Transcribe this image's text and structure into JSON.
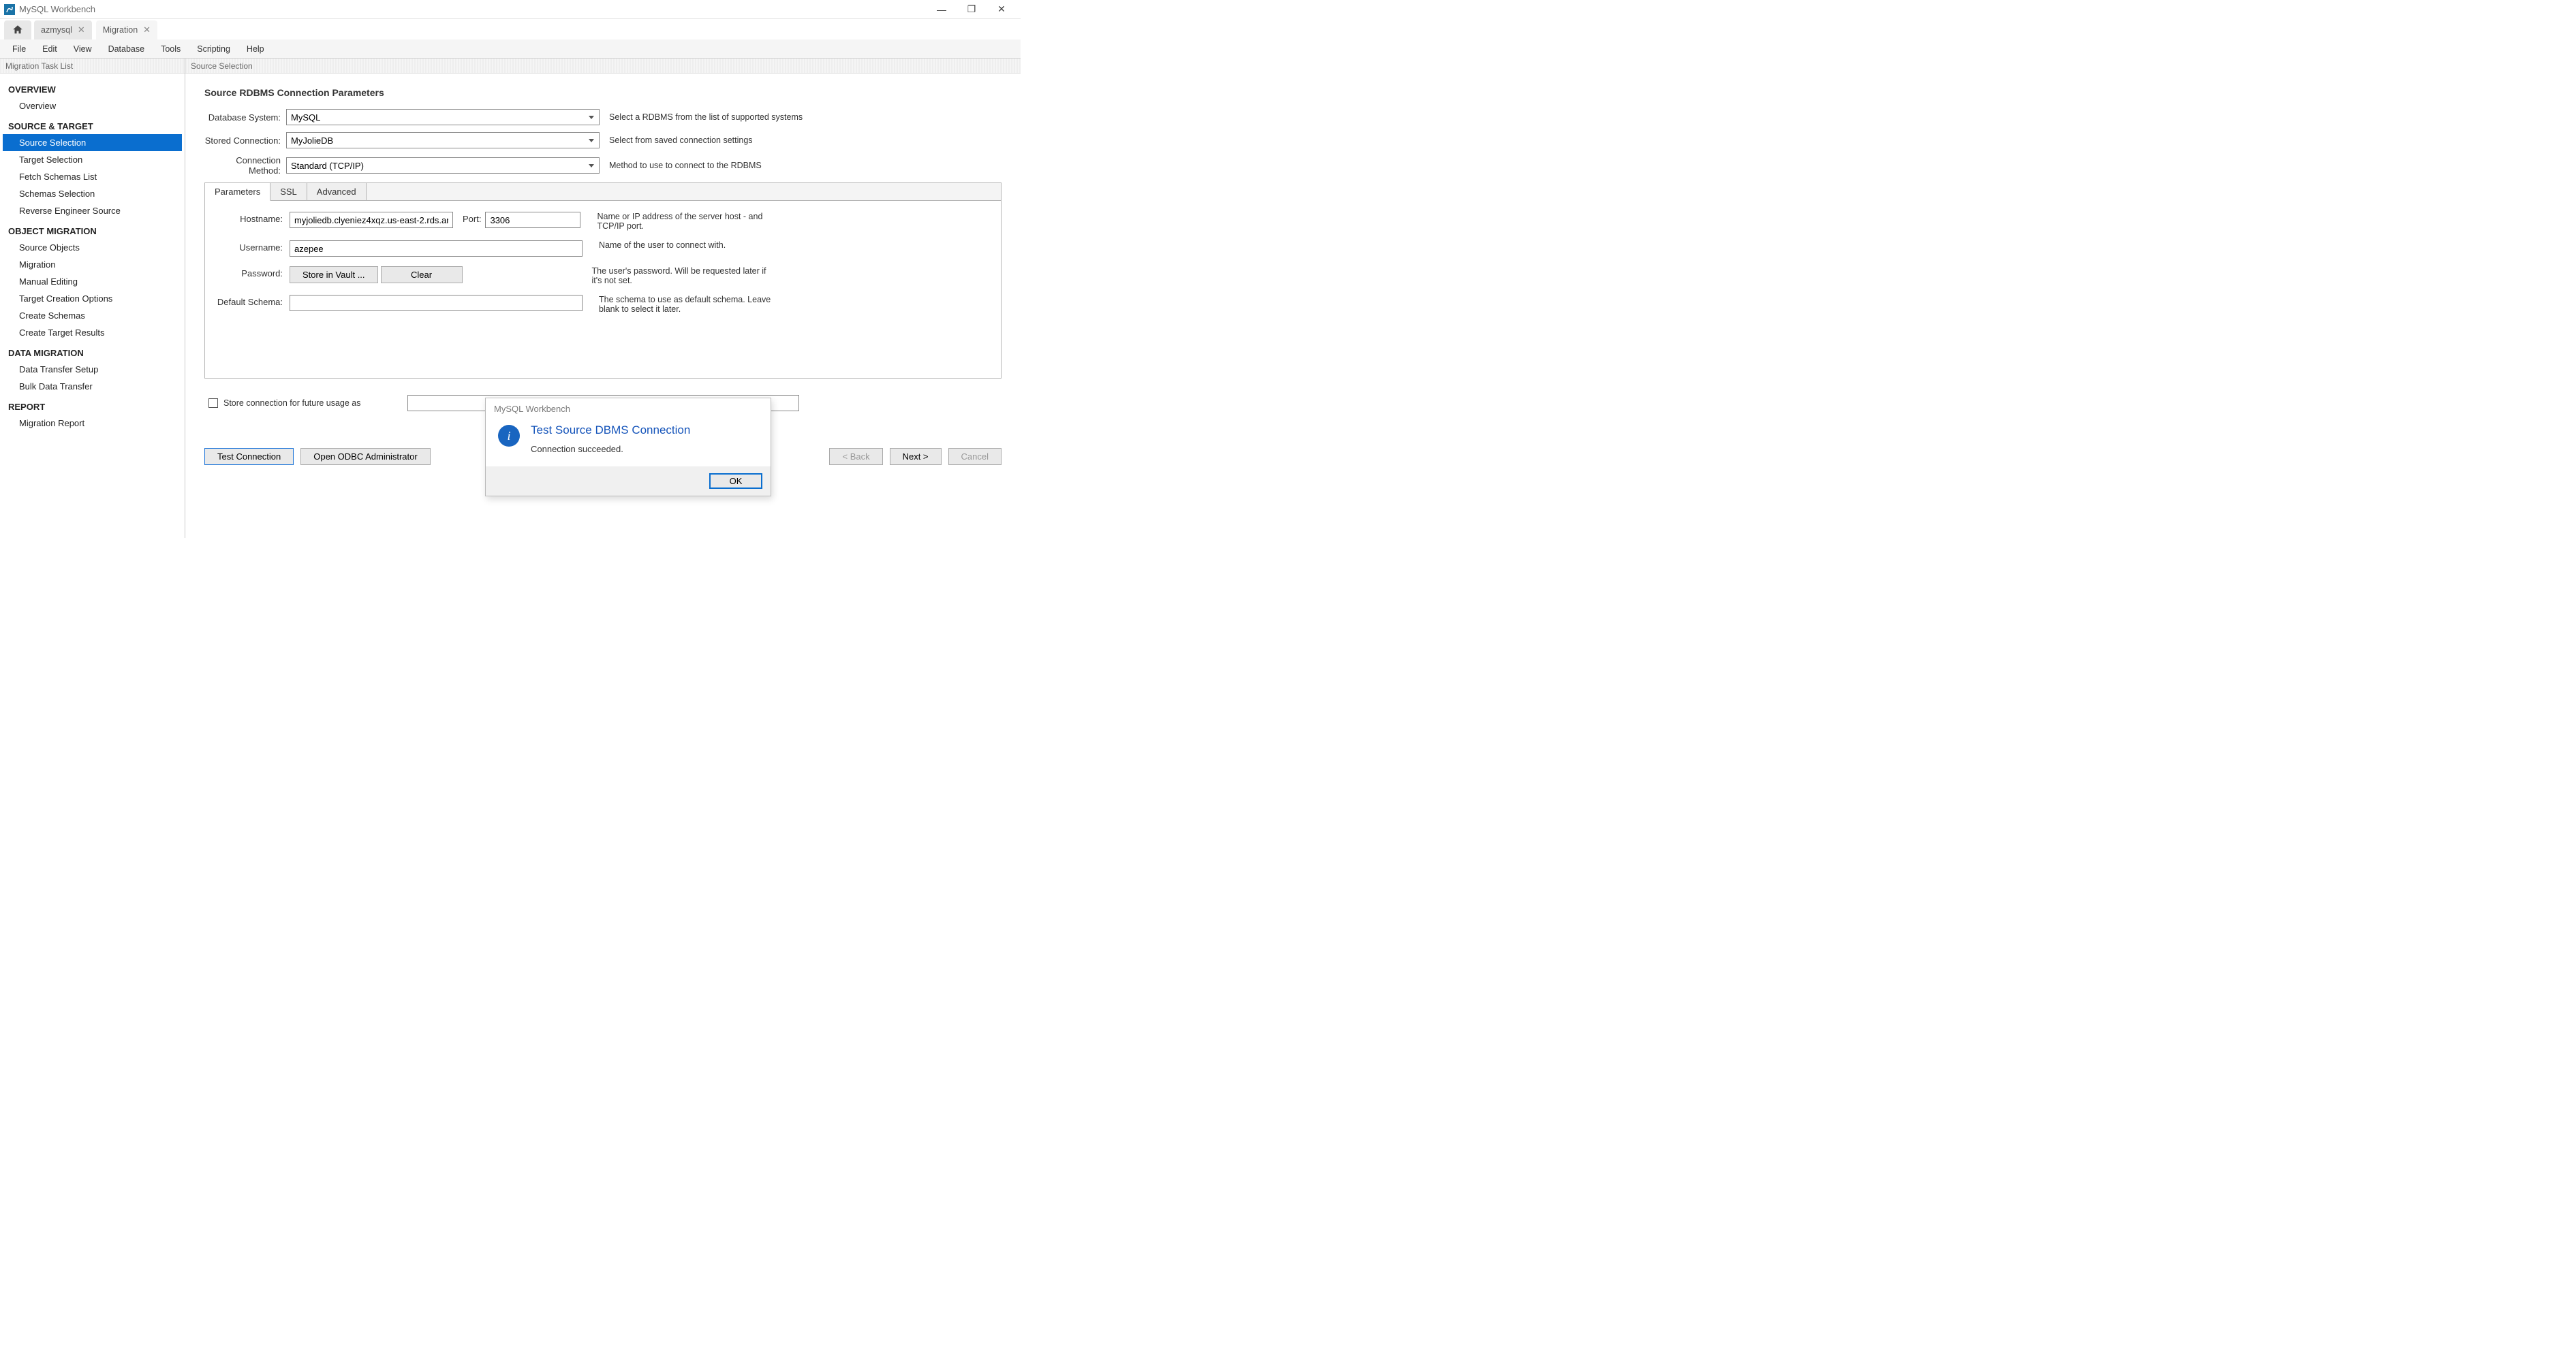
{
  "titlebar": {
    "title": "MySQL Workbench"
  },
  "tabs": {
    "tab1": "azmysql",
    "tab2": "Migration"
  },
  "menu": {
    "file": "File",
    "edit": "Edit",
    "view": "View",
    "database": "Database",
    "tools": "Tools",
    "scripting": "Scripting",
    "help": "Help"
  },
  "taskList": {
    "header": "Migration Task List",
    "groups": [
      {
        "title": "OVERVIEW",
        "items": [
          "Overview"
        ]
      },
      {
        "title": "SOURCE & TARGET",
        "items": [
          "Source Selection",
          "Target Selection",
          "Fetch Schemas List",
          "Schemas Selection",
          "Reverse Engineer Source"
        ]
      },
      {
        "title": "OBJECT MIGRATION",
        "items": [
          "Source Objects",
          "Migration",
          "Manual Editing",
          "Target Creation Options",
          "Create Schemas",
          "Create Target Results"
        ]
      },
      {
        "title": "DATA MIGRATION",
        "items": [
          "Data Transfer Setup",
          "Bulk Data Transfer"
        ]
      },
      {
        "title": "REPORT",
        "items": [
          "Migration Report"
        ]
      }
    ],
    "selected": "Source Selection"
  },
  "main": {
    "header": "Source Selection",
    "sectionTitle": "Source RDBMS Connection Parameters",
    "dbSystem": {
      "label": "Database System:",
      "value": "MySQL",
      "help": "Select a RDBMS from the list of supported systems"
    },
    "storedConn": {
      "label": "Stored Connection:",
      "value": "MyJolieDB",
      "help": "Select from saved connection settings"
    },
    "connMethod": {
      "label": "Connection Method:",
      "value": "Standard (TCP/IP)",
      "help": "Method to use to connect to the RDBMS"
    },
    "paramTabs": {
      "parameters": "Parameters",
      "ssl": "SSL",
      "advanced": "Advanced"
    },
    "params": {
      "hostname": {
        "label": "Hostname:",
        "value": "myjoliedb.clyeniez4xqz.us-east-2.rds.am",
        "portLabel": "Port:",
        "portValue": "3306",
        "help": "Name or IP address of the server host - and TCP/IP port."
      },
      "username": {
        "label": "Username:",
        "value": "azepee",
        "help": "Name of the user to connect with."
      },
      "password": {
        "label": "Password:",
        "storeBtn": "Store in Vault ...",
        "clearBtn": "Clear",
        "help": "The user's password. Will be requested later if it's not set."
      },
      "schema": {
        "label": "Default Schema:",
        "value": "",
        "help": "The schema to use as default schema. Leave blank to select it later."
      }
    },
    "storeCheck": "Store connection for future usage as",
    "buttons": {
      "test": "Test Connection",
      "odbc": "Open ODBC Administrator",
      "back": "< Back",
      "next": "Next >",
      "cancel": "Cancel"
    }
  },
  "dialog": {
    "title": "MySQL Workbench",
    "heading": "Test Source DBMS Connection",
    "message": "Connection succeeded.",
    "ok": "OK"
  }
}
